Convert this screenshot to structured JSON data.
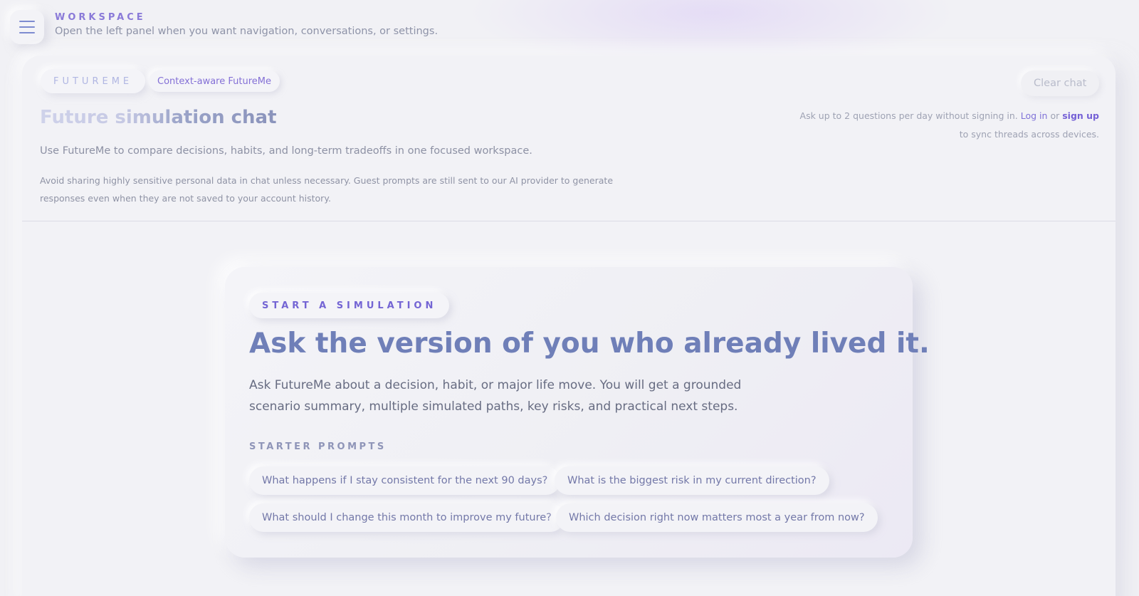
{
  "header": {
    "workspace_label": "WORKSPACE",
    "workspace_subtitle": "Open the left panel when you want navigation, conversations, or settings.",
    "menu_icon": "hamburger-menu-icon"
  },
  "chat_header": {
    "brand_pill": "FUTUREME",
    "context_pill": "Context-aware FutureMe",
    "clear_chat_label": "Clear chat",
    "title": "Future simulation chat",
    "description": "Use FutureMe to compare decisions, habits, and long-term tradeoffs in one focused workspace.",
    "privacy_warning": "Avoid sharing highly sensitive personal data in chat unless necessary. Guest prompts are still sent to our AI provider to generate responses even when they are not saved to your account history.",
    "guest_note": {
      "prefix": "Ask up to 2 questions per day without signing in.",
      "login_label": "Log in",
      "or_text": "or",
      "signup_label": "sign up",
      "suffix": "to sync threads across devices."
    }
  },
  "start_card": {
    "badge": "START A SIMULATION",
    "headline": "Ask the version of you who already lived it.",
    "body": "Ask FutureMe about a decision, habit, or major life move. You will get a grounded scenario summary, multiple simulated paths, key risks, and practical next steps.",
    "starter_label": "STARTER PROMPTS",
    "prompts": [
      "What happens if I stay consistent for the next 90 days?",
      "What is the biggest risk in my current direction?",
      "What should I change this month to improve my future?",
      "Which decision right now matters most a year from now?"
    ]
  },
  "colors": {
    "background": "#f1f1f5",
    "accent_purple": "#7561d6",
    "headline_blue": "#6f7fb8"
  }
}
